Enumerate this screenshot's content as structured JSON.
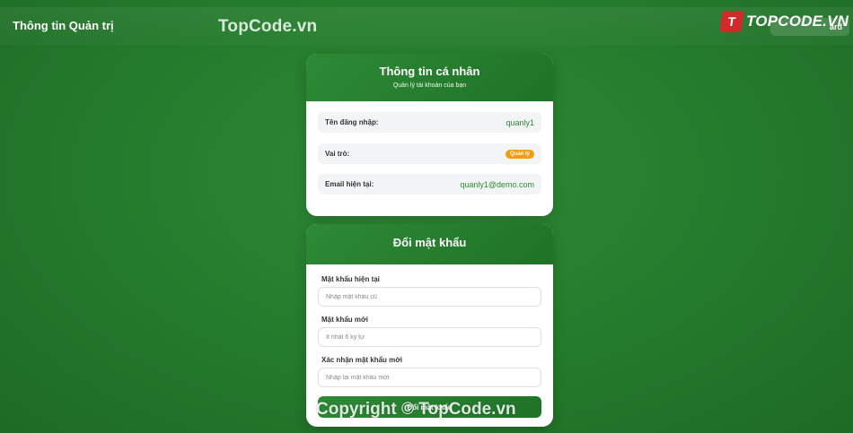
{
  "header": {
    "title": "Thông tin Quản trị",
    "dashboard_label": "ard"
  },
  "watermark": {
    "top": "TopCode.vn",
    "bottom": "Copyright © TopCode.vn",
    "logo_mark": "T",
    "logo_text": "TOPCODE.VN"
  },
  "profile": {
    "title": "Thông tin cá nhân",
    "subtitle": "Quản lý tài khoản của bạn",
    "rows": [
      {
        "label": "Tên đăng nhập:",
        "value": "quanly1"
      },
      {
        "label": "Vai trò:",
        "value": "Quản lý"
      },
      {
        "label": "Email hiện tại:",
        "value": "quanly1@demo.com"
      }
    ]
  },
  "password": {
    "title": "Đổi mật khẩu",
    "fields": [
      {
        "label": "Mật khẩu hiện tại",
        "placeholder": "Nhập mật khẩu cũ"
      },
      {
        "label": "Mật khẩu mới",
        "placeholder": "Ít nhất 6 ký tự"
      },
      {
        "label": "Xác nhận mật khẩu mới",
        "placeholder": "Nhập lại mật khẩu mới"
      }
    ],
    "submit_label": "Đổi mật khẩu"
  },
  "colors": {
    "background": "#247a2c",
    "accent": "#2c8a34",
    "badge": "#f39c12"
  }
}
